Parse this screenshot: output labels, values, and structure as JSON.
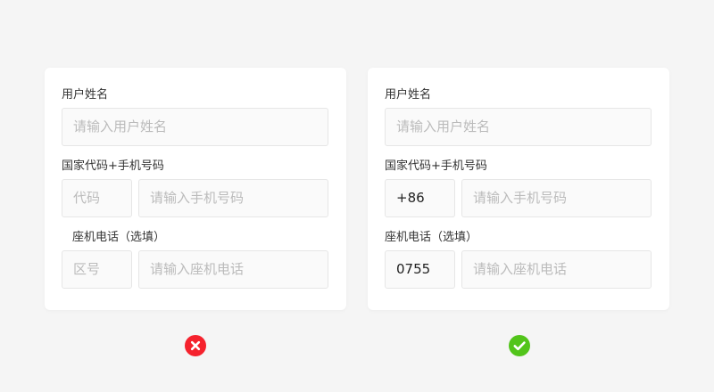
{
  "bad_form": {
    "name_label": "用户姓名",
    "name_placeholder": "请输入用户姓名",
    "mobile_label": "国家代码+手机号码",
    "country_code_placeholder": "代码",
    "mobile_placeholder": "请输入手机号码",
    "landline_label": "座机电话（选填）",
    "area_code_placeholder": "区号",
    "landline_placeholder": "请输入座机电话"
  },
  "good_form": {
    "name_label": "用户姓名",
    "name_placeholder": "请输入用户姓名",
    "mobile_label": "国家代码+手机号码",
    "country_code_value": "+86",
    "mobile_placeholder": "请输入手机号码",
    "landline_label": "座机电话（选填）",
    "area_code_value": "0755",
    "landline_placeholder": "请输入座机电话"
  },
  "status": {
    "bad_icon": "error-circle-icon",
    "good_icon": "check-circle-icon",
    "error_color": "#f5222d",
    "success_color": "#52c41a"
  }
}
